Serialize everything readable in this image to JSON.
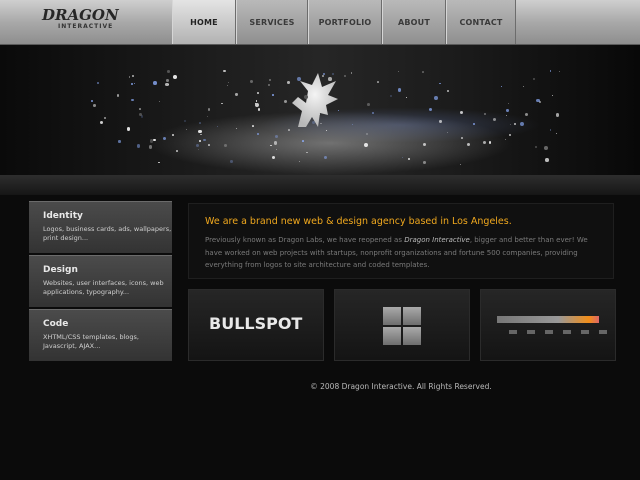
{
  "logo": {
    "main": "DRAGON",
    "sub": "INTERACTIVE"
  },
  "nav": [
    {
      "label": "HOME",
      "active": true
    },
    {
      "label": "SERVICES",
      "active": false
    },
    {
      "label": "PORTFOLIO",
      "active": false
    },
    {
      "label": "ABOUT",
      "active": false
    },
    {
      "label": "CONTACT",
      "active": false
    }
  ],
  "sidebar": [
    {
      "title": "Identity",
      "desc": "Logos, business cards, ads, wallpapers, print design..."
    },
    {
      "title": "Design",
      "desc": "Websites, user interfaces, icons, web applications, typography..."
    },
    {
      "title": "Code",
      "desc": "XHTML/CSS templates, blogs, Javascript, AJAX..."
    }
  ],
  "intro": {
    "headline": "We are a brand new web & design agency based in Los Angeles.",
    "body_before": "Previously known as Dragon Labs, we have reopened as ",
    "body_em": "Dragon Interactive",
    "body_after": ", bigger and better than ever! We have worked on web projects with startups, nonprofit organizations and fortune 500 companies, providing everything from logos to site architecture and coded templates."
  },
  "portfolio": {
    "bullspot": "BULLSPOT"
  },
  "footer": "© 2008 Dragon Interactive. All Rights Reserved.",
  "colors": {
    "accent": "#f0a81e",
    "nav_active": "#e4e4e4"
  }
}
